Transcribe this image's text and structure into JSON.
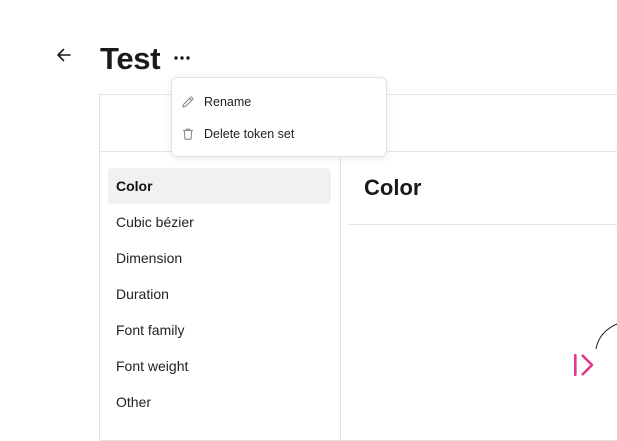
{
  "header": {
    "title": "Test",
    "back_icon": "arrow-left-icon",
    "more_icon": "more-horizontal-icon"
  },
  "context_menu": {
    "items": [
      {
        "label": "Rename",
        "icon": "pencil-icon"
      },
      {
        "label": "Delete token set",
        "icon": "trash-icon"
      }
    ]
  },
  "sidebar": {
    "items": [
      {
        "label": "Color",
        "active": true
      },
      {
        "label": "Cubic bézier",
        "active": false
      },
      {
        "label": "Dimension",
        "active": false
      },
      {
        "label": "Duration",
        "active": false
      },
      {
        "label": "Font family",
        "active": false
      },
      {
        "label": "Font weight",
        "active": false
      },
      {
        "label": "Other",
        "active": false
      }
    ]
  },
  "main": {
    "title": "Color"
  },
  "colors": {
    "accent": "#e5368c",
    "text": "#1a1a1a",
    "border": "#e3e3e3",
    "active_bg": "#f1f1f1"
  }
}
